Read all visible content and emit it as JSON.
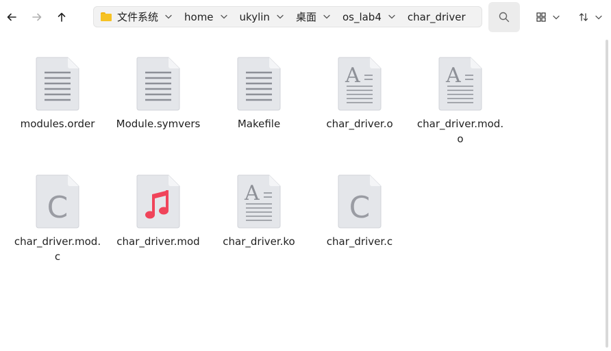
{
  "toolbar": {
    "back_icon": "arrow-left-icon",
    "forward_icon": "arrow-right-icon",
    "up_icon": "arrow-up-icon",
    "search_icon": "search-icon",
    "view_icon": "grid-view-icon",
    "sort_icon": "sort-icon"
  },
  "breadcrumb": {
    "items": [
      {
        "label": "文件系统"
      },
      {
        "label": "home"
      },
      {
        "label": "ukylin"
      },
      {
        "label": "桌面"
      },
      {
        "label": "os_lab4"
      },
      {
        "label": "char_driver"
      }
    ]
  },
  "files": [
    {
      "name": "modules.order",
      "icon": "text-document-icon"
    },
    {
      "name": "Module.symvers",
      "icon": "text-document-icon"
    },
    {
      "name": "Makefile",
      "icon": "text-document-icon"
    },
    {
      "name": "char_driver.o",
      "icon": "font-document-icon"
    },
    {
      "name": "char_driver.mod.o",
      "icon": "font-document-icon"
    },
    {
      "name": "char_driver.mod.c",
      "icon": "c-source-icon"
    },
    {
      "name": "char_driver.mod",
      "icon": "music-file-icon"
    },
    {
      "name": "char_driver.ko",
      "icon": "font-document-icon"
    },
    {
      "name": "char_driver.c",
      "icon": "c-source-icon"
    }
  ],
  "colors": {
    "accent_folder": "#f6c224",
    "music_note": "#f0445a",
    "doc_body": "#e4e6ea",
    "doc_lines": "#8d9097"
  }
}
